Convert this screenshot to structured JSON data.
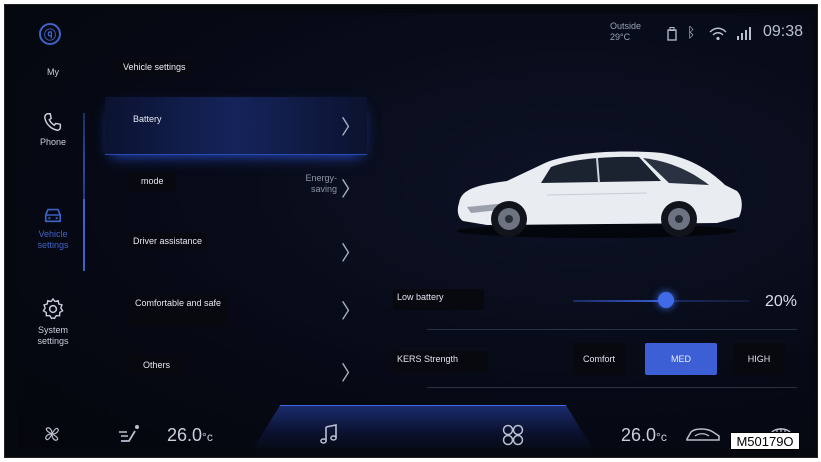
{
  "status_bar": {
    "outside_label": "Outside",
    "outside_temp": "29°C",
    "time": "09:38",
    "icons": [
      "usb-icon",
      "bluetooth-icon",
      "wifi-icon",
      "signal-4g-icon"
    ]
  },
  "sidebar": {
    "logo": "brand-logo-icon",
    "items": [
      {
        "label": "My",
        "icon": "profile-icon"
      },
      {
        "label": "Phone",
        "icon": "phone-icon"
      },
      {
        "label": "Vehicle settings",
        "icon": "car-icon",
        "active": true
      },
      {
        "label": "System settings",
        "icon": "gear-icon"
      }
    ]
  },
  "page": {
    "title": "Vehicle settings"
  },
  "menu": {
    "items": [
      {
        "label": "Battery",
        "value": ""
      },
      {
        "label": "mode",
        "value": "Energy-saving"
      },
      {
        "label": "Driver assistance",
        "value": ""
      },
      {
        "label": "Comfortable and safe",
        "value": ""
      },
      {
        "label": "Others",
        "value": ""
      }
    ]
  },
  "settings": {
    "low_battery": {
      "label": "Low battery",
      "value": "20%",
      "fraction": 0.53
    },
    "kers": {
      "label": "KERS Strength",
      "options": [
        "Comfort",
        "MED",
        "HIGH"
      ],
      "selected": "MED"
    }
  },
  "bottom_bar": {
    "left_temp": "26.0",
    "right_temp": "26.0",
    "unit": "°c",
    "icons": [
      "fan-icon",
      "seat-airflow-icon",
      "music-note-icon",
      "ac-fan-icon",
      "car-recirculation-icon",
      "rear-defrost-icon"
    ]
  },
  "reference_code": "M50179O",
  "colors": {
    "accent": "#3d5fd6",
    "background": "#070a16",
    "text": "#cfd6e6"
  }
}
